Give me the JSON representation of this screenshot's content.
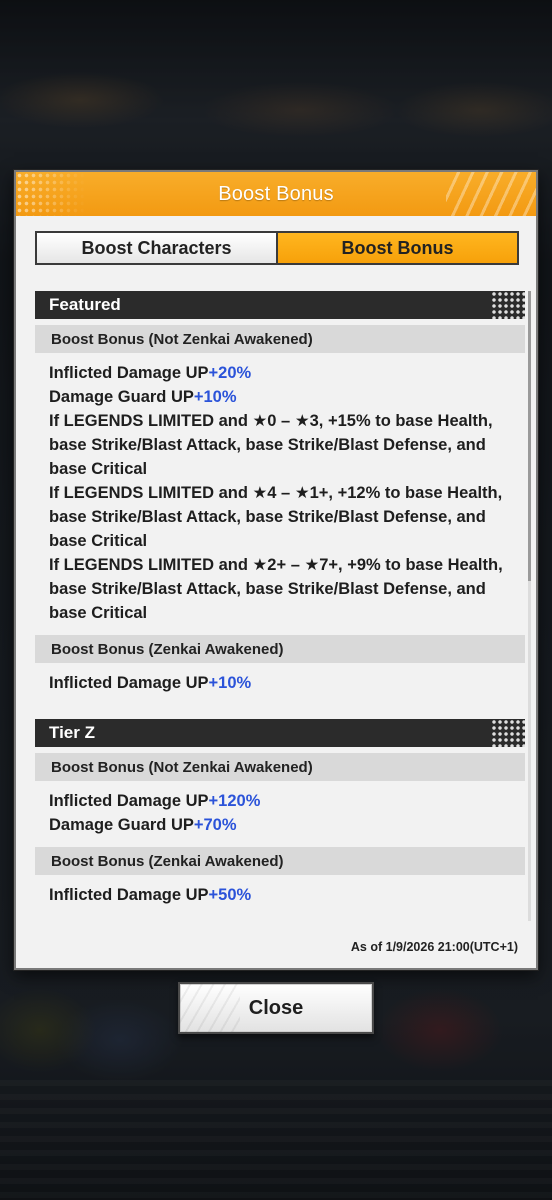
{
  "dialog": {
    "title": "Boost Bonus",
    "tabs": [
      {
        "label": "Boost Characters",
        "active": false
      },
      {
        "label": "Boost Bonus",
        "active": true
      }
    ],
    "sections": [
      {
        "title": "Featured",
        "groups": [
          {
            "title": "Boost Bonus (Not Zenkai Awakened)",
            "entries": [
              {
                "text": "Inflicted Damage UP",
                "value": "+20%"
              },
              {
                "text": "Damage Guard UP",
                "value": "+10%"
              },
              {
                "text": "If LEGENDS LIMITED and ★0 – ★3, +15% to base Health, base Strike/Blast Attack, base Strike/Blast Defense, and base Critical",
                "value": ""
              },
              {
                "text": "If LEGENDS LIMITED and ★4 – ★1+, +12% to base Health, base Strike/Blast Attack, base Strike/Blast Defense, and base Critical",
                "value": ""
              },
              {
                "text": "If LEGENDS LIMITED and ★2+ – ★7+, +9% to base Health, base Strike/Blast Attack, base Strike/Blast Defense, and base Critical",
                "value": ""
              }
            ]
          },
          {
            "title": "Boost Bonus (Zenkai Awakened)",
            "entries": [
              {
                "text": "Inflicted Damage UP",
                "value": "+10%"
              }
            ]
          }
        ]
      },
      {
        "title": "Tier Z",
        "groups": [
          {
            "title": "Boost Bonus (Not Zenkai Awakened)",
            "entries": [
              {
                "text": "Inflicted Damage UP",
                "value": "+120%"
              },
              {
                "text": "Damage Guard UP",
                "value": "+70%"
              }
            ]
          },
          {
            "title": "Boost Bonus (Zenkai Awakened)",
            "entries": [
              {
                "text": "Inflicted Damage UP",
                "value": "+50%"
              }
            ]
          }
        ]
      }
    ],
    "timestamp": "As of 1/9/2026 21:00(UTC+1)"
  },
  "close_button": {
    "label": "Close"
  },
  "colors": {
    "accent": "#f7a10a",
    "value_blue": "#2b53d9",
    "section_dark": "#2b2b2b"
  }
}
